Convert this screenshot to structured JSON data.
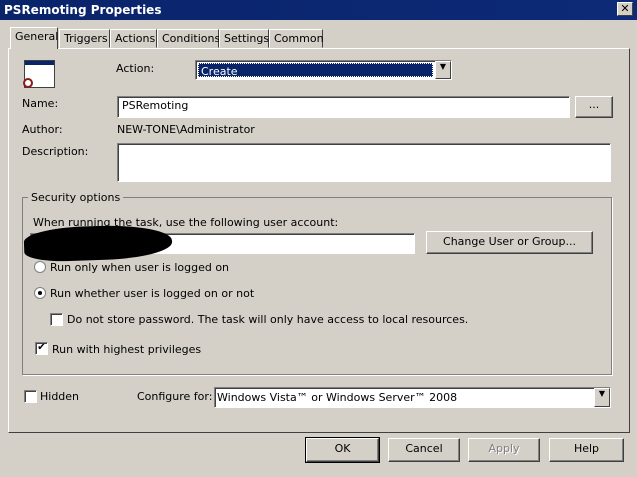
{
  "window": {
    "title": "PSRemoting Properties",
    "close": "✕"
  },
  "tabs": [
    "General",
    "Triggers",
    "Actions",
    "Conditions",
    "Settings",
    "Common"
  ],
  "general": {
    "action_label": "Action:",
    "action_value": "Create",
    "name_label": "Name:",
    "name_value": "PSRemoting",
    "browse_label": "...",
    "author_label": "Author:",
    "author_value": "NEW-TONE\\Administrator",
    "description_label": "Description:",
    "description_value": ""
  },
  "security": {
    "legend": "Security options",
    "account_prompt": "When running the task, use the following user account:",
    "account_value": "",
    "change_button": "Change User or Group...",
    "radio_logged_on": "Run only when user is logged on",
    "radio_whether": "Run whether user is logged on or not",
    "no_store_password": "Do not store password.  The task will only have access to local resources.",
    "highest_privileges": "Run with highest privileges"
  },
  "hidden_label": "Hidden",
  "configure_label": "Configure for:",
  "configure_value": "Windows Vista™ or Windows Server™ 2008",
  "buttons": {
    "ok": "OK",
    "cancel": "Cancel",
    "apply": "Apply",
    "help": "Help"
  }
}
